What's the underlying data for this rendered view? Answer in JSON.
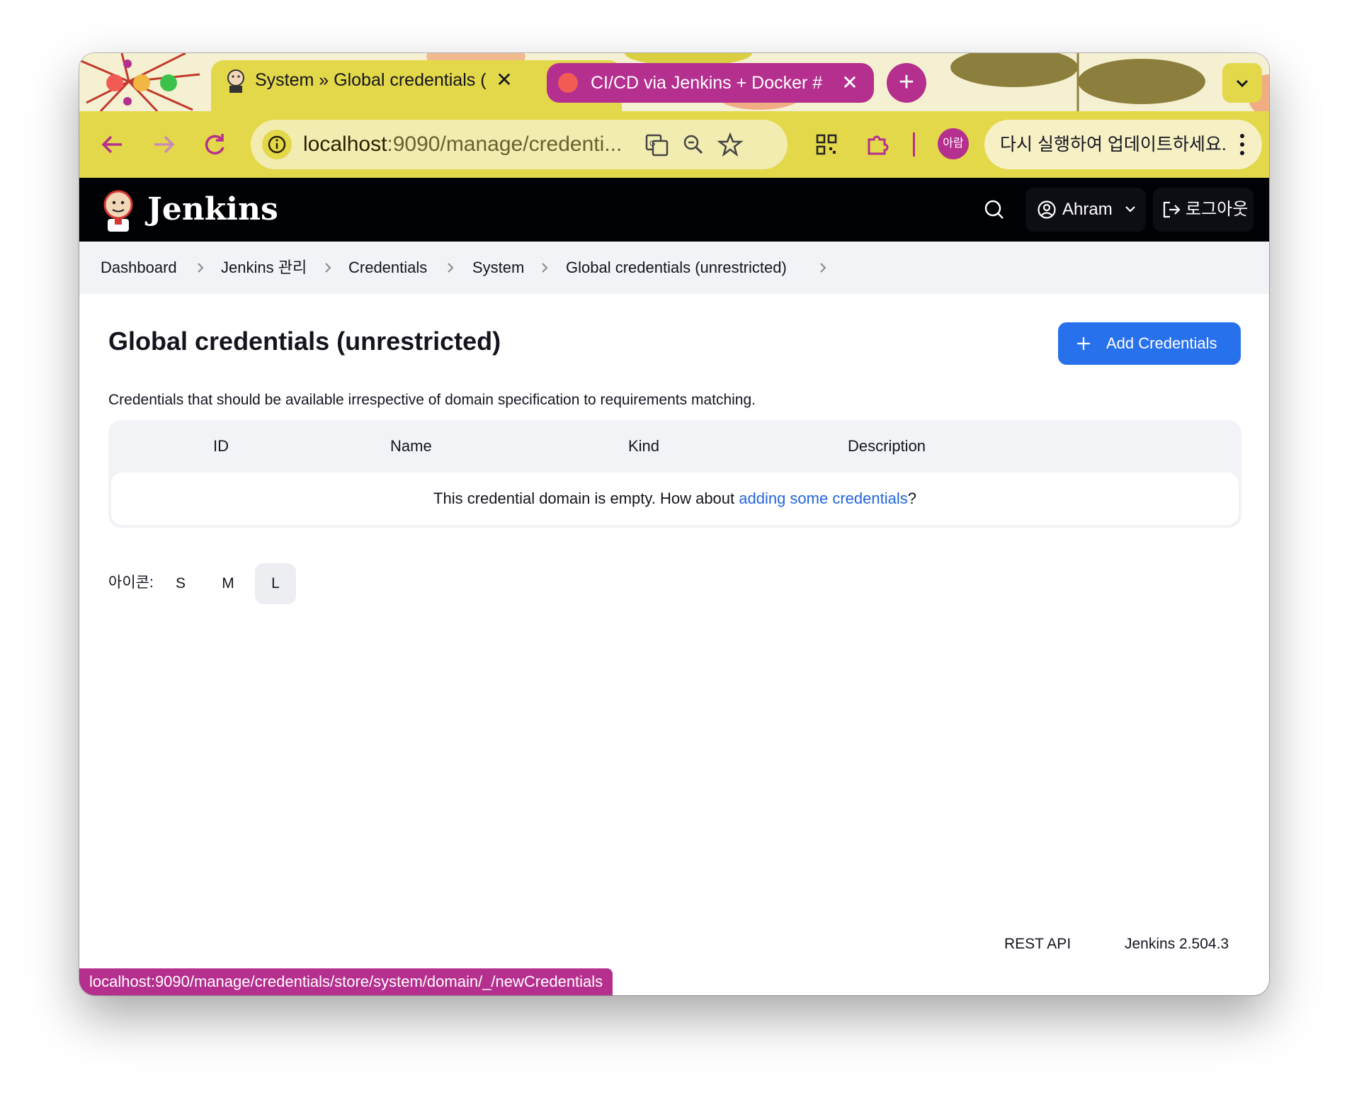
{
  "browser": {
    "tabs": [
      {
        "title": "System » Global credentials (",
        "active": true
      },
      {
        "title": "CI/CD via Jenkins + Docker #",
        "active": false
      }
    ],
    "new_tab_label": "+",
    "url_host": "localhost",
    "url_rest": ":9090/manage/credenti...",
    "profile_label": "아람",
    "update_message": "다시 실행하여 업데이트하세요.",
    "colors": {
      "accent": "#e2d84a",
      "magenta": "#b52f8e"
    }
  },
  "jenkins": {
    "logo_text": "Jenkins",
    "user_name": "Ahram",
    "logout_label": "로그아웃"
  },
  "breadcrumbs": [
    "Dashboard",
    "Jenkins 관리",
    "Credentials",
    "System",
    "Global credentials (unrestricted)"
  ],
  "page": {
    "title": "Global credentials (unrestricted)",
    "add_button": "Add Credentials",
    "description": "Credentials that should be available irrespective of domain specification to requirements matching.",
    "table_headers": [
      "ID",
      "Name",
      "Kind",
      "Description"
    ],
    "empty_prefix": "This credential domain is empty. How about ",
    "empty_link": "adding some credentials",
    "empty_suffix": "?",
    "icon_size_label": "아이콘:",
    "icon_sizes": [
      "S",
      "M",
      "L"
    ],
    "icon_size_selected": "L"
  },
  "footer": {
    "rest_api": "REST API",
    "version": "Jenkins 2.504.3"
  },
  "status_url": "localhost:9090/manage/credentials/store/system/domain/_/newCredentials"
}
